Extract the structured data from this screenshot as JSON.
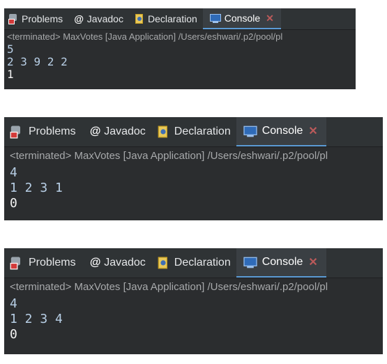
{
  "panels": [
    {
      "tabs": {
        "problems": "Problems",
        "javadoc": "Javadoc",
        "declaration": "Declaration",
        "console": "Console"
      },
      "status": "<terminated> MaxVotes [Java Application] /Users/eshwari/.p2/pool/pl",
      "output": {
        "line1": "5",
        "line2": "2 3 9 2 2",
        "result": "1"
      }
    },
    {
      "tabs": {
        "problems": "Problems",
        "javadoc": "Javadoc",
        "declaration": "Declaration",
        "console": "Console"
      },
      "status": "<terminated> MaxVotes [Java Application] /Users/eshwari/.p2/pool/pl",
      "output": {
        "line1": "4",
        "line2": "1 2 3 1",
        "result": "0"
      }
    },
    {
      "tabs": {
        "problems": "Problems",
        "javadoc": "Javadoc",
        "declaration": "Declaration",
        "console": "Console"
      },
      "status": "<terminated> MaxVotes [Java Application] /Users/eshwari/.p2/pool/pl",
      "output": {
        "line1": "4",
        "line2": "1 2 3 4",
        "result": "0"
      }
    }
  ],
  "icons": {
    "problems": "problems-icon",
    "javadoc": "javadoc-icon",
    "declaration": "declaration-icon",
    "console": "console-icon",
    "close": "close-icon"
  }
}
